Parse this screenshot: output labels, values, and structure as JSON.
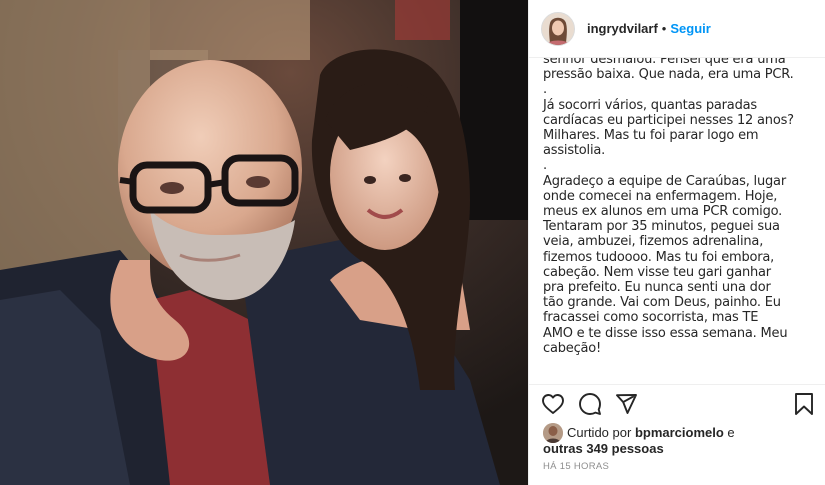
{
  "post": {
    "username": "ingrydvilarf",
    "separator": "•",
    "follow_label": "Seguir"
  },
  "caption": {
    "text": "senhor desmaiou. Pensei que era uma\npressão baixa. Que nada, era uma PCR.\n.\nJá socorri vários, quantas paradas\ncardíacas eu participei nesses 12 anos?\nMilhares. Mas tu foi parar logo em\nassistolia.\n.\nAgradeço a equipe de Caraúbas, lugar\nonde comecei na enfermagem. Hoje,\nmeus ex alunos em uma PCR comigo.\nTentaram por 35 minutos, peguei sua\nveia, ambuzei, fizemos adrenalina,\nfizemos tudoooo. Mas tu foi embora,\ncabeção. Nem visse teu gari ganhar\npra prefeito. Eu nunca senti una dor\ntão grande. Vai com Deus, painho. Eu\nfracassei como socorrista, mas TE\nAMO e te disse isso essa semana. Meu\ncabeção!"
  },
  "likes": {
    "prefix": "Curtido por",
    "user": "bpmarciomelo",
    "conjunction": "e",
    "others": "outras 349 pessoas"
  },
  "timestamp": "HÁ 15 HORAS",
  "icons": {
    "like": "heart-icon",
    "comment": "comment-icon",
    "share": "share-icon",
    "save": "bookmark-icon"
  },
  "colors": {
    "link": "#0095f6",
    "text": "#262626",
    "muted": "#8e8e8e",
    "border": "#efefef"
  }
}
